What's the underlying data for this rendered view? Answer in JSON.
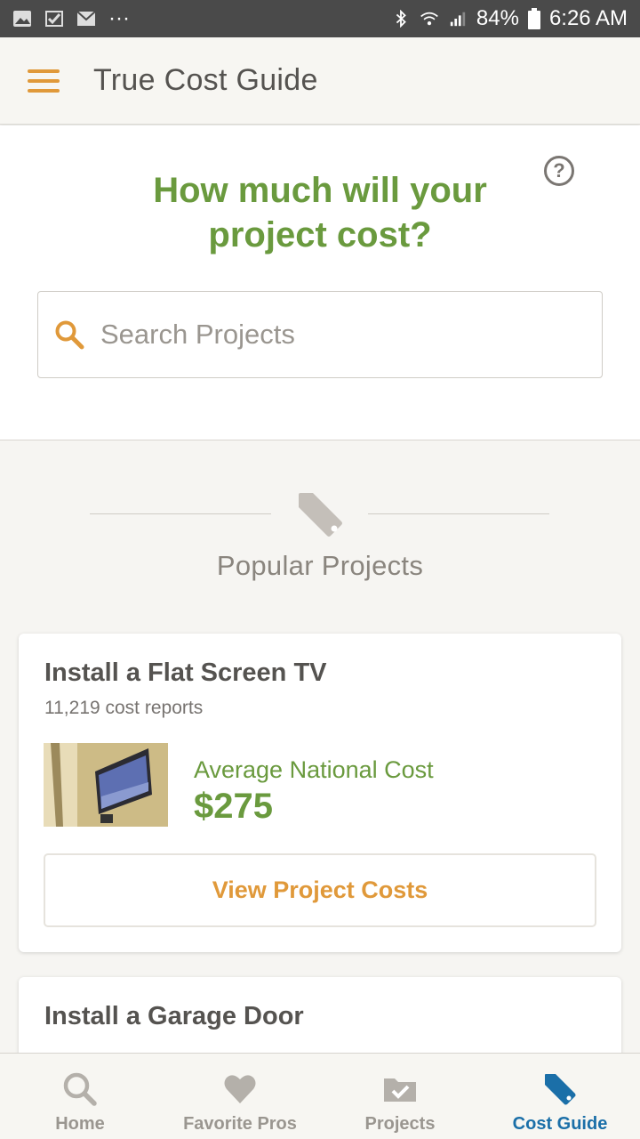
{
  "status_bar": {
    "battery": "84%",
    "time": "6:26 AM",
    "more": "···"
  },
  "app_bar": {
    "title": "True Cost Guide"
  },
  "hero": {
    "headline": "How much will your project cost?",
    "help": "?",
    "search_placeholder": "Search Projects"
  },
  "popular": {
    "title": "Popular Projects",
    "cards": [
      {
        "title": "Install a Flat Screen TV",
        "reports": "11,219 cost reports",
        "avg_label": "Average National Cost",
        "avg_value": "$275",
        "button": "View Project Costs"
      },
      {
        "title": "Install a Garage Door"
      }
    ]
  },
  "bottom_nav": {
    "items": [
      {
        "label": "Home",
        "icon": "search-icon"
      },
      {
        "label": "Favorite Pros",
        "icon": "heart-icon"
      },
      {
        "label": "Projects",
        "icon": "folder-check-icon"
      },
      {
        "label": "Cost Guide",
        "icon": "tag-icon"
      }
    ],
    "active_index": 3
  },
  "colors": {
    "accent": "#e0993a",
    "green": "#6a9a3e",
    "active_blue": "#1b6fa8"
  }
}
